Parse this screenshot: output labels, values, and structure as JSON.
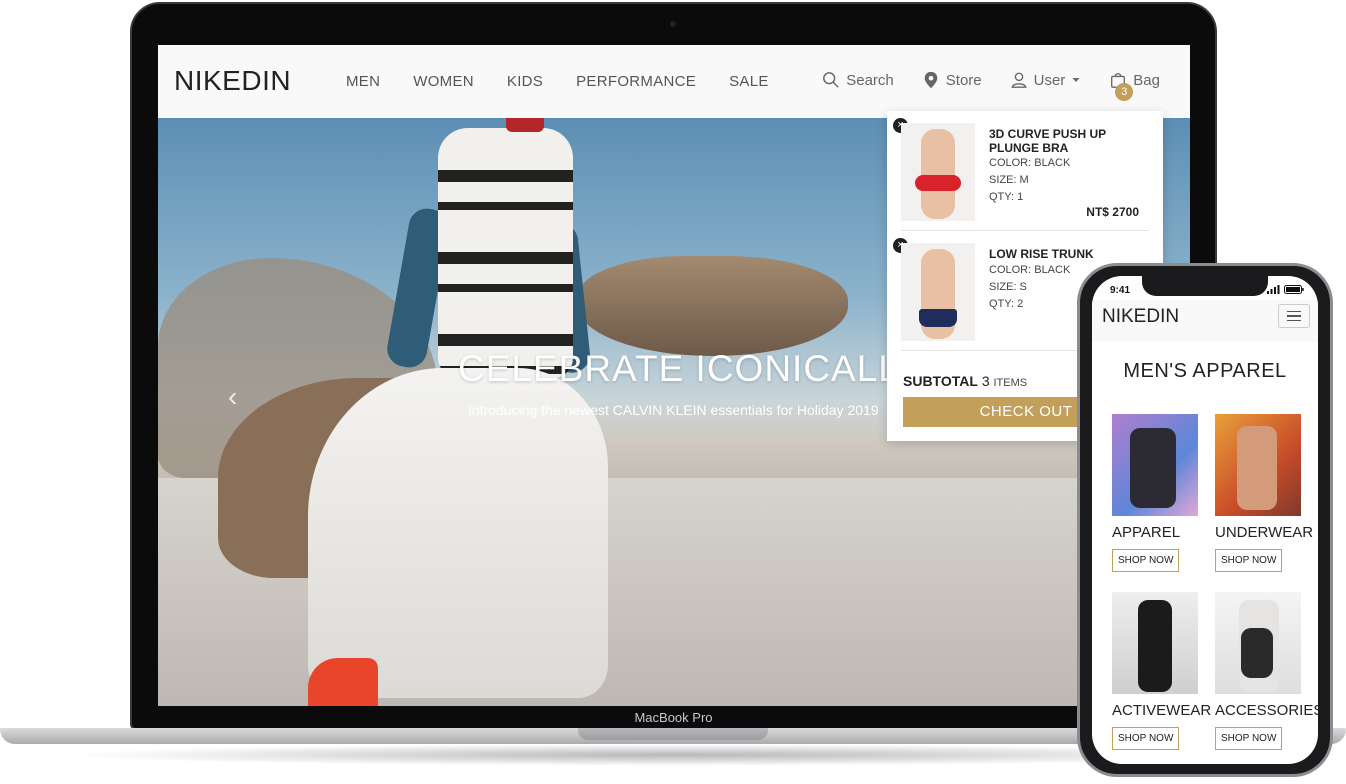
{
  "device_label": "MacBook Pro",
  "site": {
    "logo": "NIKEDIN",
    "nav": [
      "MEN",
      "WOMEN",
      "KIDS",
      "PERFORMANCE",
      "SALE"
    ],
    "tools": {
      "search": "Search",
      "store": "Store",
      "user": "User",
      "bag": "Bag",
      "bag_count": "3"
    },
    "hero": {
      "title": "CELEBRATE ICONICALLY",
      "subtitle": "Introducing the newest CALVIN KLEIN essentials for Holiday 2019"
    },
    "cart": {
      "items": [
        {
          "name": "3D CURVE PUSH UP PLUNGE BRA",
          "color": "COLOR: BLACK",
          "size": "SIZE: M",
          "qty": "QTY: 1",
          "price": "NT$ 2700"
        },
        {
          "name": "LOW RISE TRUNK",
          "color": "COLOR: BLACK",
          "size": "SIZE: S",
          "qty": "QTY: 2"
        }
      ],
      "subtotal_label": "SUBTOTAL",
      "subtotal_count": "3",
      "subtotal_unit": "ITEMS",
      "checkout": "CHECK OUT"
    }
  },
  "phone": {
    "time": "9:41",
    "logo": "NIKEDIN",
    "title": "MEN'S APPAREL",
    "categories": [
      {
        "name": "APPAREL",
        "cta": "SHOP NOW"
      },
      {
        "name": "UNDERWEAR",
        "cta": "SHOP NOW"
      },
      {
        "name": "ACTIVEWEAR",
        "cta": "SHOP NOW"
      },
      {
        "name": "ACCESSORIES",
        "cta": "SHOP NOW"
      }
    ]
  },
  "colors": {
    "accent": "#c3a05a",
    "text": "#222222",
    "header_bg": "#f9f9fa"
  }
}
